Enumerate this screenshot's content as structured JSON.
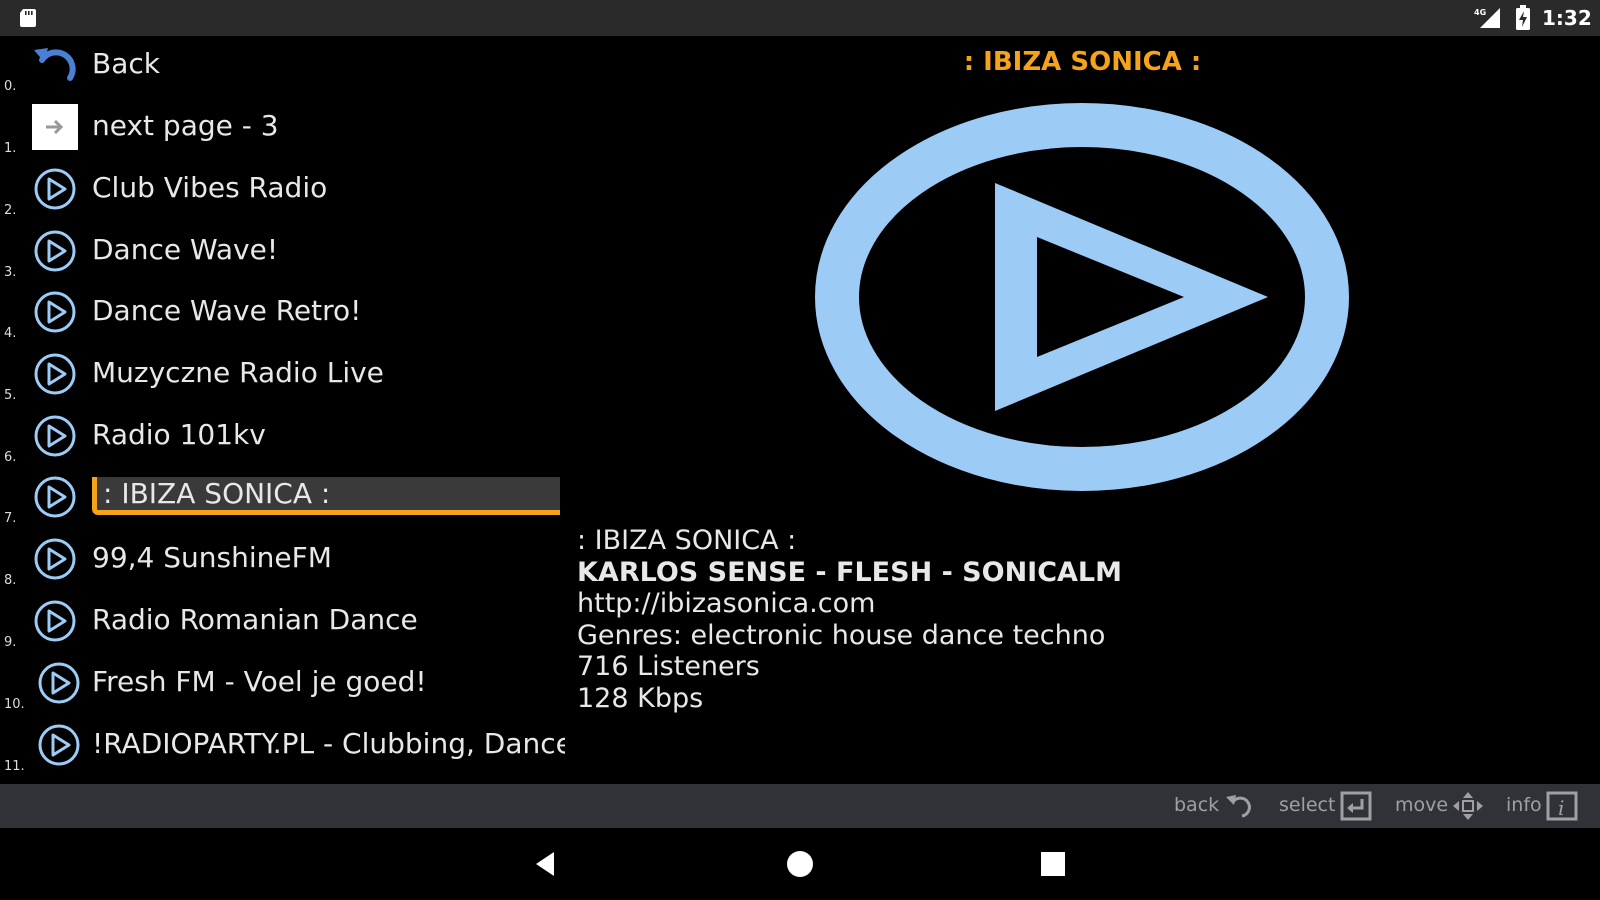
{
  "status_bar": {
    "network_type": "4G",
    "time": "1:32",
    "icons": [
      "sd-card-icon",
      "signal-icon",
      "battery-charging-icon"
    ]
  },
  "list": {
    "items": [
      {
        "index": "0.",
        "label": "Back",
        "icon": "back-arrow-icon"
      },
      {
        "index": "1.",
        "label": "next page - 3",
        "icon": "next-page-icon"
      },
      {
        "index": "2.",
        "label": "Club Vibes Radio",
        "icon": "play-circle-icon"
      },
      {
        "index": "3.",
        "label": "Dance Wave!",
        "icon": "play-circle-icon"
      },
      {
        "index": "4.",
        "label": "Dance Wave Retro!",
        "icon": "play-circle-icon"
      },
      {
        "index": "5.",
        "label": "Muzyczne Radio Live",
        "icon": "play-circle-icon"
      },
      {
        "index": "6.",
        "label": "Radio 101kv",
        "icon": "play-circle-icon"
      },
      {
        "index": "7.",
        "label": ": IBIZA SONICA :",
        "icon": "play-circle-icon",
        "selected": true
      },
      {
        "index": "8.",
        "label": "99,4 SunshineFM",
        "icon": "play-circle-icon"
      },
      {
        "index": "9.",
        "label": "Radio Romanian Dance",
        "icon": "play-circle-icon"
      },
      {
        "index": "10.",
        "label": "Fresh FM - Voel je goed!",
        "icon": "play-circle-icon"
      },
      {
        "index": "11.",
        "label": "!RADIOPARTY.PL - Clubbing, Dance,",
        "icon": "play-circle-icon"
      }
    ]
  },
  "detail": {
    "title": ": IBIZA SONICA :",
    "name": ": IBIZA SONICA :",
    "now_playing": "KARLOS SENSE - FLESH - SONICALM",
    "url": "http://ibizasonica.com",
    "genres": "Genres: electronic house dance techno",
    "listeners": "716 Listeners",
    "bitrate": "128 Kbps"
  },
  "hints": {
    "back": "back",
    "select": "select",
    "move": "move",
    "info": "info"
  },
  "colors": {
    "accent": "#f5a31a",
    "icon_blue": "#9ccbf5",
    "background": "#000000",
    "status_bar": "#2a2a2a",
    "hint_bar": "#303238"
  }
}
